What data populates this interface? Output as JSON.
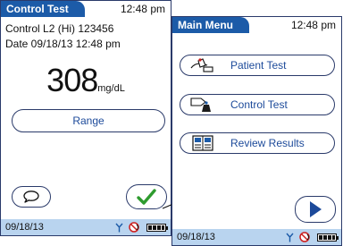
{
  "control_screen": {
    "title": "Control Test",
    "time": "12:48 pm",
    "control_line": "Control L2 (Hi) 123456",
    "date_line": "Date 09/18/13 12:48 pm",
    "value": "308",
    "unit": "mg/dL",
    "range_label": "Range",
    "status_date": "09/18/13"
  },
  "main_menu": {
    "title": "Main Menu",
    "time": "12:48 pm",
    "items": [
      {
        "label": "Patient Test",
        "icon": "patient-test-icon"
      },
      {
        "label": "Control Test",
        "icon": "control-test-icon"
      },
      {
        "label": "Review Results",
        "icon": "review-results-icon"
      }
    ],
    "status_date": "09/18/13"
  },
  "colors": {
    "title_tab": "#1c5ba8",
    "status_bar": "#b9d4ef",
    "accept_check": "#2e9b2e",
    "next_arrow": "#1c4a9a"
  }
}
